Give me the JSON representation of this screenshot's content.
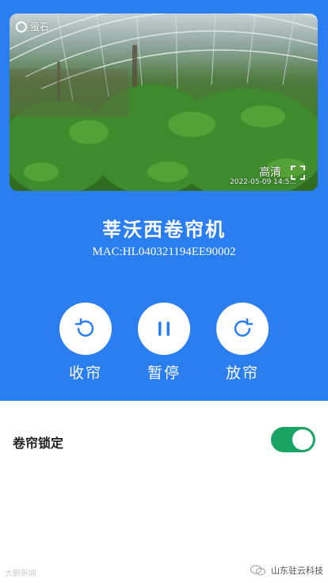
{
  "video": {
    "brand_label": "萤石",
    "quality_label": "高清",
    "timestamp": "2022-05-09 14:5..."
  },
  "device": {
    "name": "莘沃西卷帘机",
    "mac": "MAC:HL040321194EE90002"
  },
  "controls": [
    {
      "label": "收帘",
      "icon": "rotate-ccw-icon"
    },
    {
      "label": "暂停",
      "icon": "pause-icon"
    },
    {
      "label": "放帘",
      "icon": "rotate-cw-icon"
    }
  ],
  "settings": {
    "lock_label": "卷帘锁定",
    "lock_enabled": true
  },
  "watermark": {
    "left": "大鹏新闻",
    "right": "山东驻云科技"
  },
  "colors": {
    "primary": "#2a7ef0",
    "toggle_on": "#19a463",
    "button_icon": "#2a7ef0"
  }
}
